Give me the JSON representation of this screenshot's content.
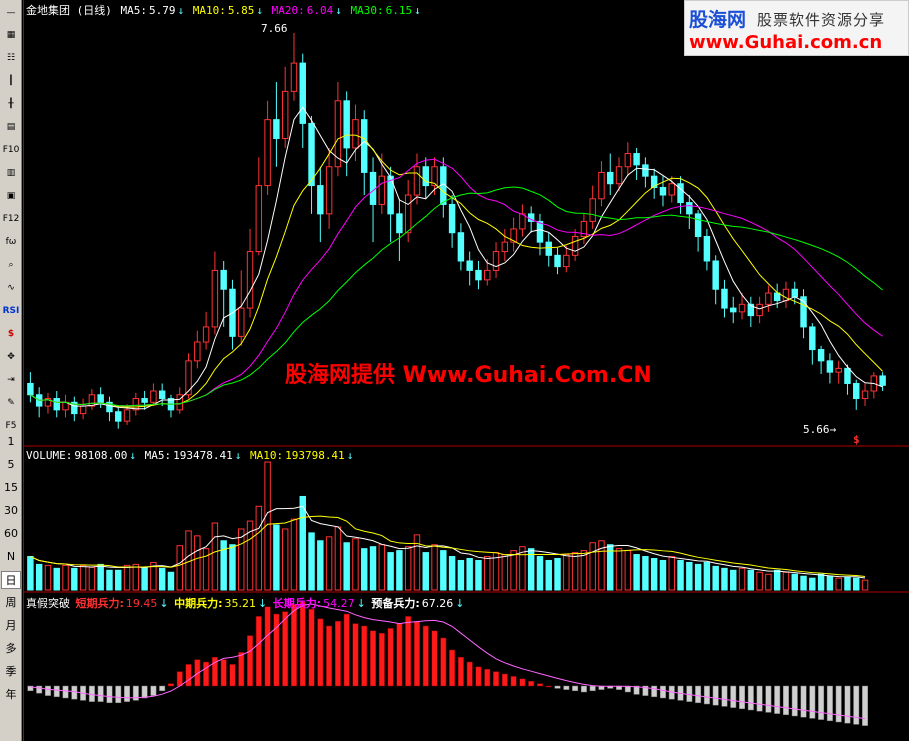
{
  "toolbar": {
    "icons": [
      "minus-icon",
      "grid-icon",
      "table-icon",
      "candle-icon",
      "candle-up-icon",
      "chart-list-icon",
      "f10-icon",
      "finance-icon",
      "notes-icon",
      "f12-icon",
      "fx-icon",
      "search-icon",
      "wave-icon",
      "rsi-icon",
      "dollar-icon",
      "move-icon",
      "export-icon",
      "pencil-icon",
      "f5-icon"
    ],
    "labels": {
      "f10": "F10",
      "f12": "F12",
      "rsi": "RSI",
      "f5": "F5",
      "fx": "fω"
    },
    "periods": [
      "1",
      "5",
      "15",
      "30",
      "60",
      "N",
      "日",
      "周",
      "月",
      "多",
      "季",
      "年"
    ],
    "active_period": "日"
  },
  "main_header": {
    "title": "金地集团 (日线)",
    "ma5_label": "MA5:",
    "ma5_value": "5.79",
    "ma10_label": "MA10:",
    "ma10_value": "5.85",
    "ma20_label": "MA20:",
    "ma20_value": "6.04",
    "ma30_label": "MA30:",
    "ma30_value": "6.15"
  },
  "volume_header": {
    "vol_label": "VOLUME:",
    "vol_value": "98108.00",
    "ma5_label": "MA5:",
    "ma5_value": "193478.41",
    "ma10_label": "MA10:",
    "ma10_value": "193798.41"
  },
  "indicator_header": {
    "name": "真假突破",
    "short_label": "短期兵力:",
    "short_value": "19.45",
    "mid_label": "中期兵力:",
    "mid_value": "35.21",
    "long_label": "长期兵力:",
    "long_value": "54.27",
    "reserve_label": "预备兵力:",
    "reserve_value": "67.26"
  },
  "annotations": {
    "high": "7.66",
    "low": "5.66→",
    "signal": "$"
  },
  "watermark": "股海网提供 Www.Guhai.Com.CN",
  "logo": {
    "brand": "股海网",
    "slogan": "股票软件资源分享",
    "url": "www.Guhai.com.cn"
  },
  "colors": {
    "up": "#ff3333",
    "down": "#54ffff",
    "ma5": "#ffffff",
    "ma10": "#ffff00",
    "ma20": "#ff00ff",
    "ma30": "#00ff00",
    "bar_red": "#ff1a1a",
    "bar_grey": "#cfcfcf"
  },
  "chart_data": {
    "type": "candlestick",
    "price_range": [
      5.5,
      7.75
    ],
    "high": 7.66,
    "low": 5.66,
    "candles": [
      [
        5.8,
        5.74,
        5.86,
        5.7
      ],
      [
        5.74,
        5.68,
        5.78,
        5.62
      ],
      [
        5.68,
        5.72,
        5.75,
        5.64
      ],
      [
        5.72,
        5.66,
        5.76,
        5.62
      ],
      [
        5.66,
        5.7,
        5.74,
        5.62
      ],
      [
        5.7,
        5.64,
        5.73,
        5.6
      ],
      [
        5.64,
        5.68,
        5.72,
        5.61
      ],
      [
        5.68,
        5.74,
        5.77,
        5.66
      ],
      [
        5.74,
        5.7,
        5.78,
        5.67
      ],
      [
        5.7,
        5.65,
        5.73,
        5.6
      ],
      [
        5.65,
        5.6,
        5.68,
        5.56
      ],
      [
        5.6,
        5.66,
        5.69,
        5.58
      ],
      [
        5.66,
        5.72,
        5.75,
        5.63
      ],
      [
        5.72,
        5.7,
        5.76,
        5.66
      ],
      [
        5.7,
        5.76,
        5.8,
        5.68
      ],
      [
        5.76,
        5.72,
        5.8,
        5.68
      ],
      [
        5.72,
        5.66,
        5.74,
        5.62
      ],
      [
        5.66,
        5.74,
        5.78,
        5.64
      ],
      [
        5.74,
        5.92,
        5.96,
        5.72
      ],
      [
        5.92,
        6.02,
        6.08,
        5.88
      ],
      [
        6.02,
        6.1,
        6.18,
        5.98
      ],
      [
        6.1,
        6.4,
        6.5,
        6.06
      ],
      [
        6.4,
        6.3,
        6.45,
        6.1
      ],
      [
        6.3,
        6.05,
        6.35,
        5.98
      ],
      [
        6.05,
        6.2,
        6.4,
        6.0
      ],
      [
        6.2,
        6.5,
        6.62,
        6.15
      ],
      [
        6.5,
        6.85,
        7.0,
        6.48
      ],
      [
        6.85,
        7.2,
        7.3,
        6.8
      ],
      [
        7.2,
        7.1,
        7.4,
        6.95
      ],
      [
        7.1,
        7.35,
        7.48,
        7.05
      ],
      [
        7.35,
        7.5,
        7.66,
        7.3
      ],
      [
        7.5,
        7.18,
        7.55,
        7.05
      ],
      [
        7.18,
        6.85,
        7.22,
        6.7
      ],
      [
        6.85,
        6.7,
        6.95,
        6.55
      ],
      [
        6.7,
        6.95,
        7.05,
        6.62
      ],
      [
        6.95,
        7.3,
        7.4,
        6.9
      ],
      [
        7.3,
        7.05,
        7.35,
        6.9
      ],
      [
        7.05,
        7.2,
        7.28,
        6.98
      ],
      [
        7.2,
        6.92,
        7.25,
        6.8
      ],
      [
        6.92,
        6.75,
        7.0,
        6.55
      ],
      [
        6.75,
        6.9,
        7.02,
        6.7
      ],
      [
        6.9,
        6.7,
        6.95,
        6.55
      ],
      [
        6.7,
        6.6,
        6.78,
        6.45
      ],
      [
        6.6,
        6.8,
        6.88,
        6.55
      ],
      [
        6.8,
        6.95,
        7.02,
        6.75
      ],
      [
        6.95,
        6.85,
        7.0,
        6.78
      ],
      [
        6.85,
        6.95,
        7.0,
        6.8
      ],
      [
        6.95,
        6.75,
        7.0,
        6.68
      ],
      [
        6.75,
        6.6,
        6.8,
        6.52
      ],
      [
        6.6,
        6.45,
        6.65,
        6.4
      ],
      [
        6.45,
        6.4,
        6.5,
        6.32
      ],
      [
        6.4,
        6.35,
        6.45,
        6.3
      ],
      [
        6.35,
        6.4,
        6.46,
        6.32
      ],
      [
        6.4,
        6.5,
        6.55,
        6.36
      ],
      [
        6.5,
        6.55,
        6.62,
        6.45
      ],
      [
        6.55,
        6.62,
        6.68,
        6.5
      ],
      [
        6.62,
        6.7,
        6.75,
        6.58
      ],
      [
        6.7,
        6.66,
        6.74,
        6.6
      ],
      [
        6.66,
        6.55,
        6.7,
        6.48
      ],
      [
        6.55,
        6.48,
        6.6,
        6.42
      ],
      [
        6.48,
        6.42,
        6.52,
        6.38
      ],
      [
        6.42,
        6.48,
        6.53,
        6.39
      ],
      [
        6.48,
        6.58,
        6.62,
        6.45
      ],
      [
        6.58,
        6.66,
        6.7,
        6.54
      ],
      [
        6.66,
        6.78,
        6.85,
        6.62
      ],
      [
        6.78,
        6.92,
        6.98,
        6.74
      ],
      [
        6.92,
        6.86,
        7.02,
        6.8
      ],
      [
        6.86,
        6.95,
        7.0,
        6.82
      ],
      [
        6.95,
        7.02,
        7.08,
        6.9
      ],
      [
        7.02,
        6.96,
        7.05,
        6.88
      ],
      [
        6.96,
        6.9,
        7.0,
        6.84
      ],
      [
        6.9,
        6.84,
        6.94,
        6.78
      ],
      [
        6.84,
        6.8,
        6.9,
        6.74
      ],
      [
        6.8,
        6.86,
        6.9,
        6.76
      ],
      [
        6.86,
        6.76,
        6.9,
        6.7
      ],
      [
        6.76,
        6.7,
        6.8,
        6.62
      ],
      [
        6.7,
        6.58,
        6.72,
        6.5
      ],
      [
        6.58,
        6.45,
        6.62,
        6.4
      ],
      [
        6.45,
        6.3,
        6.48,
        6.22
      ],
      [
        6.3,
        6.2,
        6.35,
        6.15
      ],
      [
        6.2,
        6.18,
        6.26,
        6.12
      ],
      [
        6.18,
        6.22,
        6.28,
        6.14
      ],
      [
        6.22,
        6.16,
        6.26,
        6.1
      ],
      [
        6.16,
        6.22,
        6.26,
        6.12
      ],
      [
        6.22,
        6.28,
        6.32,
        6.18
      ],
      [
        6.28,
        6.24,
        6.33,
        6.2
      ],
      [
        6.24,
        6.3,
        6.34,
        6.2
      ],
      [
        6.3,
        6.26,
        6.34,
        6.22
      ],
      [
        6.26,
        6.1,
        6.3,
        6.04
      ],
      [
        6.1,
        5.98,
        6.12,
        5.9
      ],
      [
        5.98,
        5.92,
        6.0,
        5.85
      ],
      [
        5.92,
        5.86,
        5.96,
        5.8
      ],
      [
        5.86,
        5.88,
        5.92,
        5.8
      ],
      [
        5.88,
        5.8,
        5.9,
        5.74
      ],
      [
        5.8,
        5.72,
        5.82,
        5.66
      ],
      [
        5.72,
        5.76,
        5.8,
        5.68
      ],
      [
        5.76,
        5.84,
        5.86,
        5.72
      ],
      [
        5.84,
        5.79,
        5.86,
        5.76
      ]
    ],
    "volume": [
      34,
      26,
      25,
      22,
      25,
      22,
      25,
      23,
      26,
      20,
      20,
      25,
      26,
      23,
      28,
      22,
      18,
      45,
      60,
      55,
      42,
      68,
      50,
      46,
      62,
      70,
      85,
      130,
      66,
      62,
      72,
      95,
      58,
      50,
      54,
      64,
      48,
      52,
      42,
      44,
      46,
      38,
      40,
      44,
      56,
      38,
      46,
      40,
      34,
      30,
      32,
      30,
      34,
      38,
      36,
      40,
      44,
      42,
      34,
      30,
      32,
      36,
      38,
      40,
      48,
      50,
      46,
      42,
      40,
      36,
      34,
      32,
      30,
      34,
      30,
      28,
      26,
      28,
      24,
      22,
      20,
      22,
      20,
      18,
      16,
      20,
      18,
      16,
      14,
      12,
      16,
      14,
      12,
      13,
      12,
      10
    ],
    "indicator": [
      -4,
      -6,
      -8,
      -9,
      -10,
      -11,
      -12,
      -13,
      -13,
      -14,
      -14,
      -13,
      -12,
      -10,
      -8,
      -4,
      2,
      12,
      18,
      22,
      20,
      24,
      22,
      18,
      28,
      42,
      58,
      66,
      60,
      62,
      68,
      70,
      64,
      56,
      50,
      54,
      60,
      52,
      50,
      46,
      44,
      48,
      52,
      58,
      54,
      50,
      46,
      40,
      30,
      24,
      20,
      16,
      14,
      12,
      10,
      8,
      6,
      4,
      2,
      0,
      -2,
      -3,
      -4,
      -5,
      -4,
      -3,
      -2,
      -3,
      -5,
      -7,
      -8,
      -9,
      -10,
      -11,
      -12,
      -13,
      -14,
      -15,
      -16,
      -17,
      -18,
      -19,
      -20,
      -21,
      -22,
      -23,
      -24,
      -25,
      -26,
      -27,
      -28,
      -29,
      -30,
      -31,
      -32,
      -33
    ]
  }
}
